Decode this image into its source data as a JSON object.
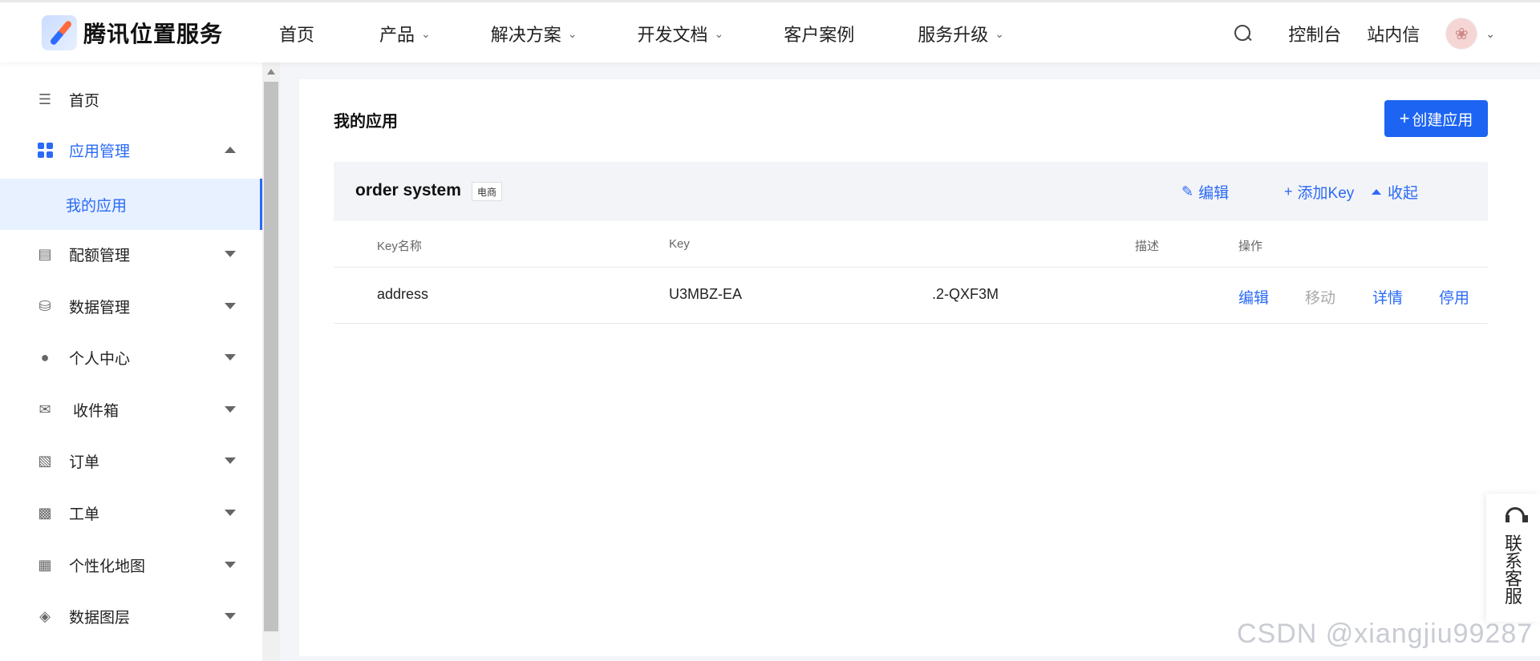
{
  "brand": {
    "name": "腾讯位置服务"
  },
  "nav": {
    "items": [
      {
        "label": "首页",
        "has_dropdown": false
      },
      {
        "label": "产品",
        "has_dropdown": true
      },
      {
        "label": "解决方案",
        "has_dropdown": true
      },
      {
        "label": "开发文档",
        "has_dropdown": true
      },
      {
        "label": "客户案例",
        "has_dropdown": false
      },
      {
        "label": "服务升级",
        "has_dropdown": true
      }
    ],
    "right": {
      "console": "控制台",
      "inbox": "站内信"
    }
  },
  "sidebar": {
    "items": [
      {
        "label": "首页",
        "icon": "list-icon"
      },
      {
        "label": "应用管理",
        "icon": "grid-icon",
        "expanded": true
      },
      {
        "label": "我的应用",
        "sub": true,
        "selected": true
      },
      {
        "label": "配额管理",
        "icon": "chart-icon"
      },
      {
        "label": "数据管理",
        "icon": "database-icon"
      },
      {
        "label": "个人中心",
        "icon": "user-icon"
      },
      {
        "label": "收件箱",
        "icon": "mail-icon"
      },
      {
        "label": "订单",
        "icon": "clipboard-icon"
      },
      {
        "label": "工单",
        "icon": "ticket-icon"
      },
      {
        "label": "个性化地图",
        "icon": "map-style-icon"
      },
      {
        "label": "数据图层",
        "icon": "layers-icon"
      }
    ]
  },
  "main": {
    "title": "我的应用",
    "create_button": "创建应用",
    "app": {
      "name": "order system",
      "tag": "电商",
      "actions": {
        "edit": "编辑",
        "add_key": "添加Key",
        "collapse": "收起"
      },
      "columns": [
        "Key名称",
        "Key",
        "描述",
        "操作"
      ],
      "rows": [
        {
          "key_name": "address",
          "key_prefix": "U3MBZ-EA",
          "key_suffix": ".2-QXF3M",
          "description": "",
          "ops": {
            "edit": "编辑",
            "move": "移动",
            "detail": "详情",
            "disable": "停用"
          }
        }
      ]
    }
  },
  "service": {
    "label": "联系客服"
  },
  "watermark": "CSDN @xiangjiu99287",
  "colors": {
    "accent": "#2a6af7",
    "primary_button": "#1d64f2",
    "selected_bg": "#e8f1ff"
  }
}
